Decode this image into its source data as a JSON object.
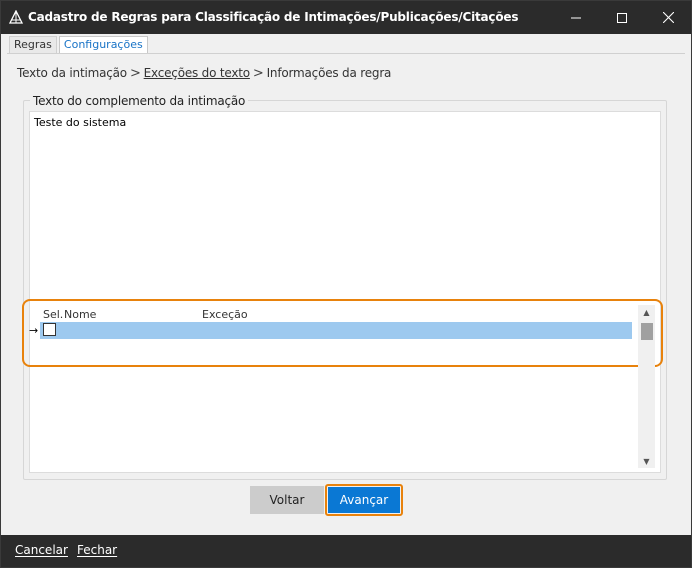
{
  "window": {
    "title": "Cadastro de Regras para Classificação de Intimações/Publicações/Citações",
    "icons": {
      "app": "triangle-app-icon",
      "minimize": "minimize-icon",
      "maximize": "maximize-icon",
      "close": "close-icon"
    }
  },
  "tabs": [
    {
      "label": "Regras",
      "active": false
    },
    {
      "label": "Configurações",
      "active": true
    }
  ],
  "breadcrumb": {
    "step1": "Texto da intimação",
    "sep": ">",
    "step2": "Exceções do texto",
    "step3": "Informações da regra"
  },
  "group": {
    "legend": "Texto do complemento da intimação",
    "text": "Teste do sistema"
  },
  "grid": {
    "columns": [
      "Sel.",
      "Nome",
      "Exceção"
    ],
    "row_pointer": "→",
    "rows": [
      {
        "selected": false,
        "nome": "",
        "excecao": ""
      }
    ]
  },
  "buttons": {
    "back": "Voltar",
    "next": "Avançar"
  },
  "footer": {
    "cancel": "Cancelar",
    "close": "Fechar"
  },
  "colors": {
    "titlebar": "#2b2b2b",
    "accent": "#0a78d4",
    "highlight": "#e8820c",
    "row_selected": "#9dc9ef"
  }
}
